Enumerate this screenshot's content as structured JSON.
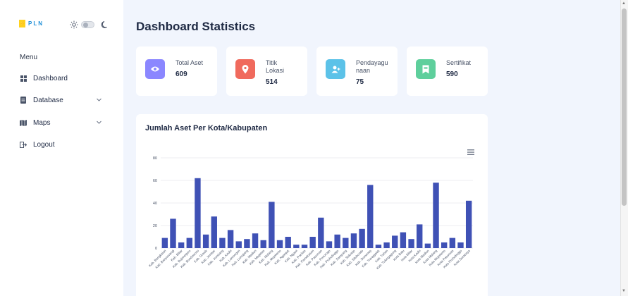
{
  "brand": {
    "name": "PLN",
    "logo_glyph": "⚡"
  },
  "sidebar": {
    "menu_label": "Menu",
    "items": [
      {
        "label": "Dashboard",
        "icon": "grid-icon",
        "has_submenu": false
      },
      {
        "label": "Database",
        "icon": "database-icon",
        "has_submenu": true
      },
      {
        "label": "Maps",
        "icon": "map-icon",
        "has_submenu": true
      },
      {
        "label": "Logout",
        "icon": "logout-icon",
        "has_submenu": false
      }
    ]
  },
  "theme_toggle": {
    "light_icon": "sun-icon",
    "dark_icon": "moon-icon",
    "is_dark": false
  },
  "page": {
    "title": "Dashboard Statistics"
  },
  "cards": [
    {
      "label": "Total Aset",
      "value": "609",
      "icon": "eye-icon",
      "color": "#8b87ff"
    },
    {
      "label": "Titik Lokasi",
      "value": "514",
      "icon": "location-pin-icon",
      "color": "#f06a5d"
    },
    {
      "label": "Pendayagunaan",
      "value": "75",
      "icon": "user-add-icon",
      "color": "#5cc2e8"
    },
    {
      "label": "Sertifikat",
      "value": "590",
      "icon": "certificate-icon",
      "color": "#5ecf9c"
    }
  ],
  "chart_data": {
    "type": "bar",
    "title": "Jumlah Aset Per Kota/Kabupaten",
    "ylim": [
      0,
      80
    ],
    "yticks": [
      0,
      20,
      40,
      60,
      80
    ],
    "grid": true,
    "color": "#3f51b5",
    "categories": [
      "Kab. Bangkalan",
      "Kab. Banyuwangi",
      "Kab. Blitar",
      "Kab. Bojonegoro",
      "Kab. Bondowoso",
      "Kab. Gresik",
      "Kab. Jember",
      "Kab. Jombang",
      "Kab. Kediri",
      "Kab. Lamongan",
      "Kab. Lumajang",
      "Kab. Madiun",
      "Kab. Magetan",
      "Kab. Malang",
      "Kab. Mojokerto",
      "Kab. Nganjuk",
      "Kab. Ngawi",
      "Kab. Pacitan",
      "Kab. Pamekasan",
      "Kab. Pasuruan",
      "Kab. Ponorogo",
      "Kab. Probolinggo",
      "Kab. Sampang",
      "Kab. Sidoarjo",
      "Kab. Situbondo",
      "Kab. Sumenep",
      "Kab. Trenggalek",
      "Kab. Tuban",
      "Kab. Tulungagung",
      "Kota Batu",
      "Kota Blitar",
      "Kota Kediri",
      "Kota Madiun",
      "Kota Malang",
      "Kota Mojokerto",
      "Kota Pasuruan",
      "Kota Probolinggo",
      "Kota Surabaya"
    ],
    "values": [
      9,
      26,
      5,
      9,
      62,
      12,
      28,
      9,
      16,
      6,
      8,
      13,
      7,
      41,
      7,
      10,
      3,
      3,
      10,
      27,
      6,
      12,
      9,
      13,
      17,
      56,
      3,
      5,
      11,
      14,
      8,
      21,
      4,
      58,
      5,
      9,
      5,
      42
    ]
  },
  "chart_toolbar": {
    "menu_icon": "hamburger-menu-icon"
  }
}
